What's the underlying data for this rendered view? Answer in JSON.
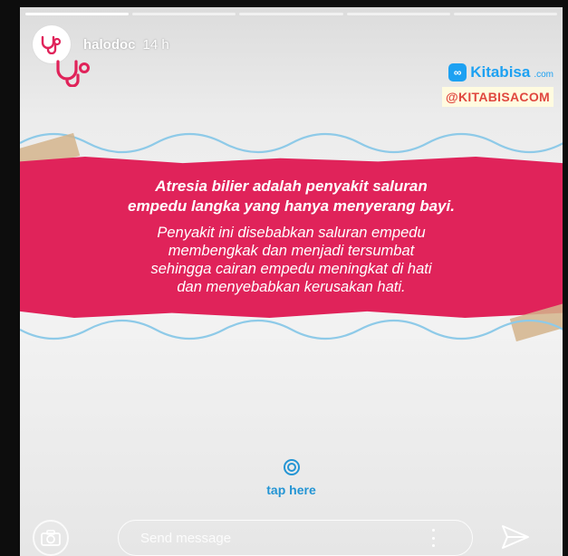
{
  "story": {
    "progress_segments": 5,
    "progress_done": 1
  },
  "header": {
    "username": "halodoc",
    "time": "14 h",
    "avatar_icon": "stethoscope-icon"
  },
  "brand": {
    "icon": "stethoscope-icon",
    "color": "#e0235a"
  },
  "sponsor": {
    "logo_mark": "∞",
    "logo_name": "Kitabisa",
    "logo_suffix": ".com",
    "handle": "@KITABISACOM",
    "brand_color": "#1da1f2",
    "handle_color": "#e0473f"
  },
  "banner": {
    "title_line1": "Atresia bilier adalah penyakit saluran",
    "title_line2": "empedu langka yang hanya menyerang bayi.",
    "body_line1": "Penyakit ini disebabkan saluran empedu",
    "body_line2": "membengkak dan menjadi tersumbat",
    "body_line3": "sehingga cairan empedu meningkat di hati",
    "body_line4": "dan menyebabkan kerusakan hati.",
    "color": "#e0235a"
  },
  "cta": {
    "label": "tap here",
    "icon": "target-icon",
    "color": "#2495d4"
  },
  "reply_bar": {
    "camera_icon": "camera-icon",
    "placeholder": "Send message",
    "more_icon": "more-vertical-icon",
    "send_icon": "send-icon"
  }
}
